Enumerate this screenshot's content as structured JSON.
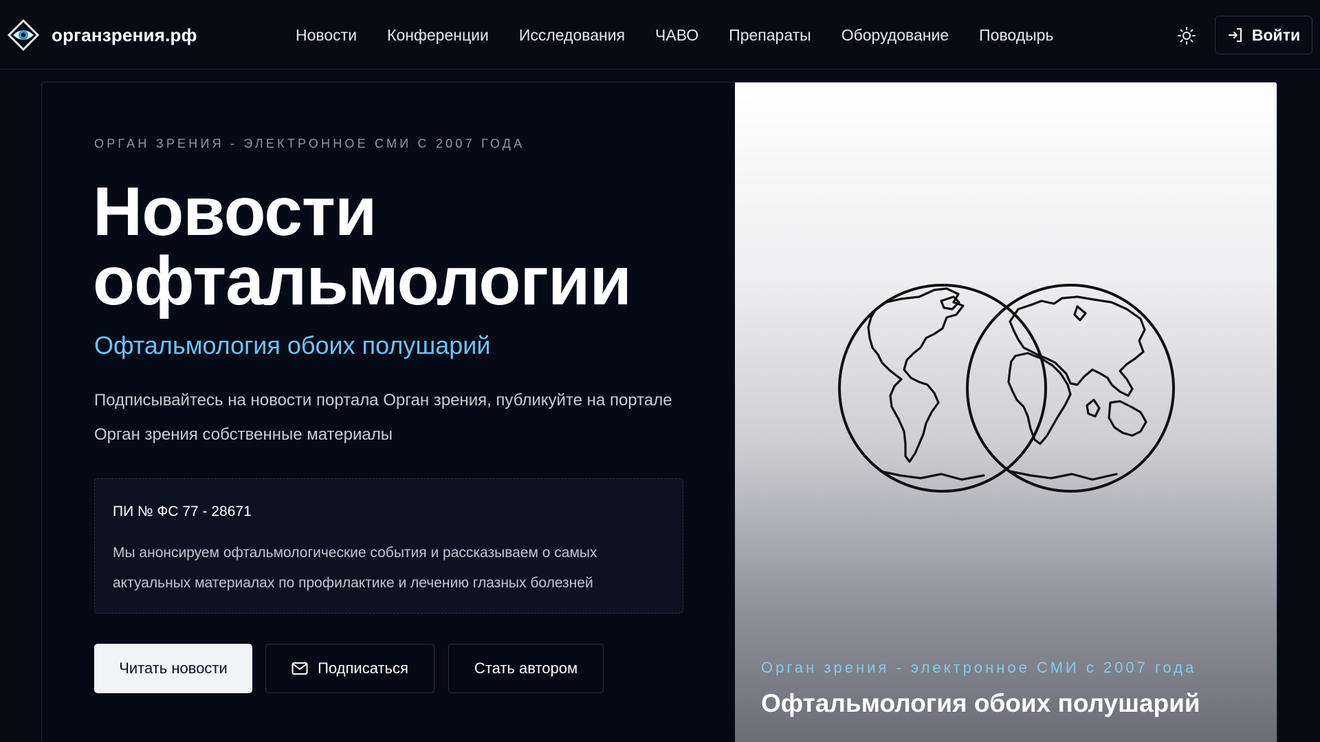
{
  "header": {
    "brand": "органзрения.рф",
    "logo_icon": "eye-logo-icon",
    "nav": [
      "Новости",
      "Конференции",
      "Исследования",
      "ЧАВО",
      "Препараты",
      "Оборудование",
      "Поводырь"
    ],
    "theme_icon": "sun-icon",
    "login_icon": "sign-in-icon",
    "login_label": "Войти"
  },
  "hero": {
    "eyebrow": "ОРГАН ЗРЕНИЯ - ЭЛЕКТРОННОЕ СМИ С 2007 ГОДА",
    "headline_line1": "Новости",
    "headline_line2": "офтальмологии",
    "subhead": "Офтальмология обоих полушарий",
    "lead": "Подписывайтесь на новости портала Орган зрения, публикуйте на портале Орган зрения собственные материалы",
    "info": {
      "title": "ПИ № ФС 77 - 28671",
      "text": "Мы анонсируем офтальмологические события и рассказываем о самых актуальных материалах по профилактике и лечению глазных болезней"
    },
    "buttons": {
      "read": "Читать новости",
      "subscribe": "Подписаться",
      "subscribe_icon": "mail-icon",
      "author": "Стать автором"
    }
  },
  "media": {
    "image_icon": "two-hemispheres-globe-icon",
    "caption_top": "Орган зрения - электронное СМИ с 2007 года",
    "caption_title": "Офтальмология обоих полушарий"
  },
  "colors": {
    "background": "#070b16",
    "accent": "#6cc4f4",
    "primary_button": "#f1f3f7"
  }
}
